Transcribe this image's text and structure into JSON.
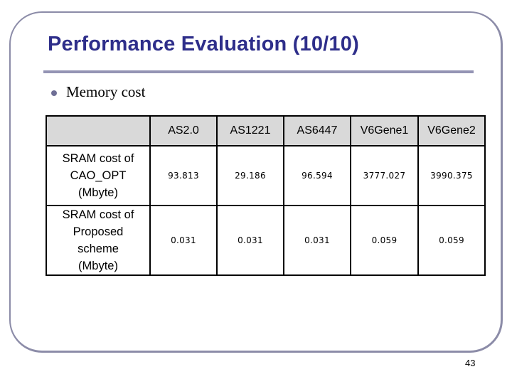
{
  "slide": {
    "title": "Performance Evaluation (10/10)",
    "bullets": [
      {
        "icon": "bullet-dot-icon",
        "text": "Memory cost"
      }
    ],
    "page_number": "43",
    "colors": {
      "title": "#2e2e8a",
      "frame": "#8c8ca8",
      "rule": "#9494b4",
      "bullet": "#6f6f96",
      "table_header_bg": "#d9d9d9"
    }
  },
  "table": {
    "corner": "",
    "columns": [
      "AS2.0",
      "AS1221",
      "AS6447",
      "V6Gene1",
      "V6Gene2"
    ],
    "rows": [
      {
        "label_lines": [
          "SRAM cost of",
          "CAO_OPT",
          "(Mbyte)"
        ],
        "values": [
          "93.813",
          "29.186",
          "96.594",
          "3777.027",
          "3990.375"
        ]
      },
      {
        "label_lines": [
          "SRAM cost of",
          "Proposed",
          "scheme",
          "(Mbyte)"
        ],
        "values": [
          "0.031",
          "0.031",
          "0.031",
          "0.059",
          "0.059"
        ]
      }
    ]
  }
}
